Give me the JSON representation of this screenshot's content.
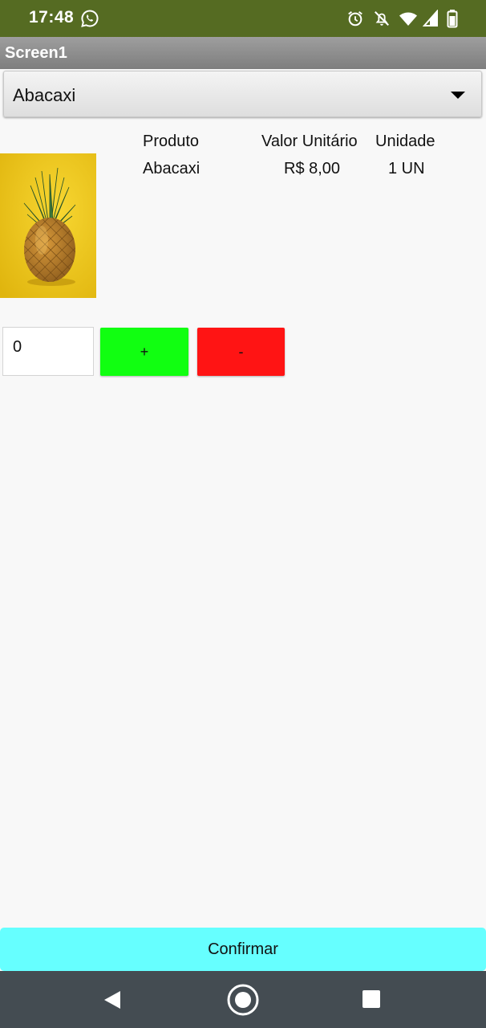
{
  "status_bar": {
    "time": "17:48",
    "icons": [
      "whatsapp-icon",
      "alarm-icon",
      "notifications-off-icon",
      "wifi-icon",
      "cell-signal-icon",
      "battery-icon"
    ],
    "color": "#556b22"
  },
  "title_bar": {
    "title": "Screen1"
  },
  "spinner": {
    "selected": "Abacaxi",
    "icon": "dropdown-arrow-icon"
  },
  "product_table": {
    "headers": [
      "Produto",
      "Valor Unitário",
      "Unidade"
    ],
    "row": [
      "Abacaxi",
      "R$ 8,00",
      "1 UN"
    ]
  },
  "product_image": {
    "subject": "pineapple",
    "background_color": "#f2cc1a"
  },
  "quantity": {
    "value": "0",
    "plus_label": "+",
    "minus_label": "-",
    "plus_color": "#11ff11",
    "minus_color": "#ff1414"
  },
  "confirm": {
    "label": "Confirmar",
    "color": "#66ffff"
  },
  "nav_bar": {
    "icons": [
      "back-icon",
      "home-icon",
      "recents-icon"
    ]
  }
}
